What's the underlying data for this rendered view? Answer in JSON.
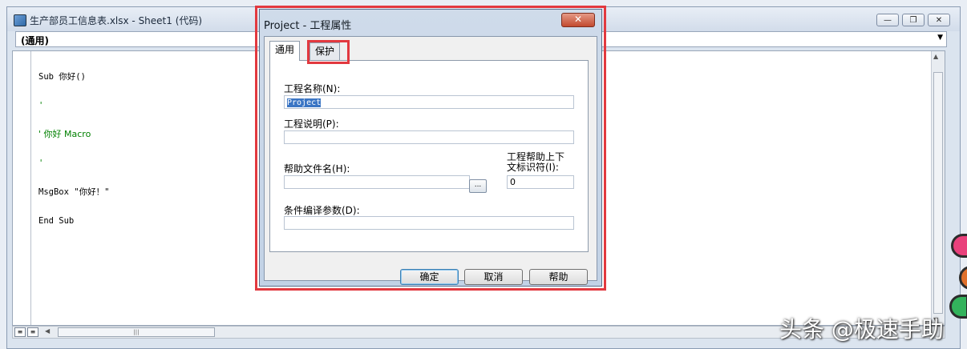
{
  "window": {
    "title": "生产部员工信息表.xlsx - Sheet1 (代码)",
    "procedure": "(通用)"
  },
  "code": {
    "lines": [
      {
        "text": "Sub 你好()",
        "comment": false
      },
      {
        "text": "'",
        "comment": true
      },
      {
        "text": "' 你好 Macro",
        "comment": true
      },
      {
        "text": "'",
        "comment": true
      },
      {
        "text": "MsgBox \"你好！\"",
        "comment": false
      },
      {
        "text": "End Sub",
        "comment": false
      }
    ]
  },
  "dialog": {
    "title": "Project - 工程属性",
    "close_label": "✕",
    "tabs": [
      {
        "label": "通用",
        "active": true
      },
      {
        "label": "保护",
        "active": false
      }
    ],
    "fields": {
      "project_name_label": "工程名称(N):",
      "project_name_value": "Project",
      "project_desc_label": "工程说明(P):",
      "project_desc_value": "",
      "help_file_label": "帮助文件名(H):",
      "help_file_value": "",
      "browse_label": "...",
      "context_id_label_1": "工程帮助上下",
      "context_id_label_2": "文标识符(I):",
      "context_id_value": "0",
      "cond_args_label": "条件编译参数(D):",
      "cond_args_value": ""
    },
    "buttons": {
      "ok": "确定",
      "cancel": "取消",
      "help": "帮助"
    }
  },
  "watermark": "头条 @极速手助",
  "colors": {
    "highlight": "#e2393f",
    "comment": "#008000",
    "selection": "#3a75c4"
  }
}
